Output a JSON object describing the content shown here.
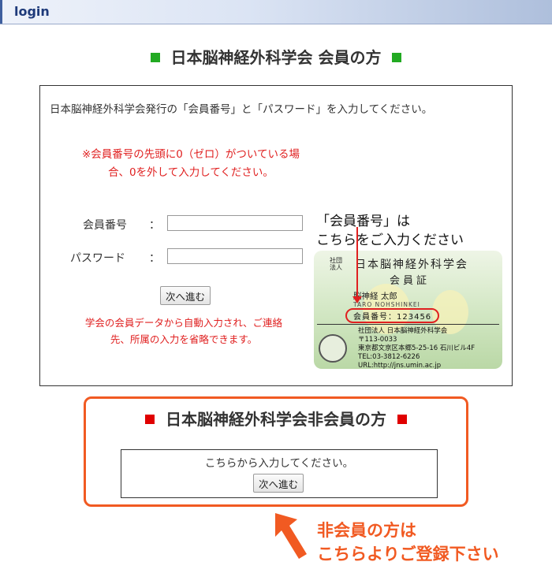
{
  "header": {
    "title": "login"
  },
  "member": {
    "heading": "日本脳神経外科学会 会員の方",
    "instruction": "日本脳神経外科学会発行の「会員番号」と「パスワード」を入力してください。",
    "zero_note": "※会員番号の先頭に0（ゼロ）がついている場合、0を外して入力してください。",
    "member_no_label": "会員番号",
    "password_label": "パスワード",
    "colon": "：",
    "member_no_value": "",
    "password_value": "",
    "next_button": "次へ進む",
    "auto_note": "学会の会員データから自動入力され、ご連絡先、所属の入力を省略できます。",
    "card_caption_line1": "「会員番号」は",
    "card_caption_line2": "こちらをご入力ください",
    "card": {
      "soc_line1": "社団",
      "soc_line2": "法人",
      "org": "日本脳神経外科学会",
      "type": "会員証",
      "name": "脳神経 太郎",
      "roma": "TARO NOHSHINKEI",
      "number": "会員番号：123456",
      "addr": [
        "社団法人 日本脳神経外科学会",
        "〒113-0033",
        "東京都文京区本郷5-25-16 石川ビル4F",
        "TEL:03-3812-6226",
        "URL:http://jns.umin.ac.jp"
      ]
    }
  },
  "nonmember": {
    "heading": "日本脳神経外科学会非会員の方",
    "text": "こちらから入力してください。",
    "next_button": "次へ進む"
  },
  "promo": {
    "line1": "非会員の方は",
    "line2": "こちらよりご登録下さい"
  },
  "colors": {
    "green_marker": "#22aa22",
    "red_marker": "#e00000",
    "orange_accent": "#f15a22",
    "note_red": "#e02020",
    "header_text": "#1e3a7a"
  }
}
